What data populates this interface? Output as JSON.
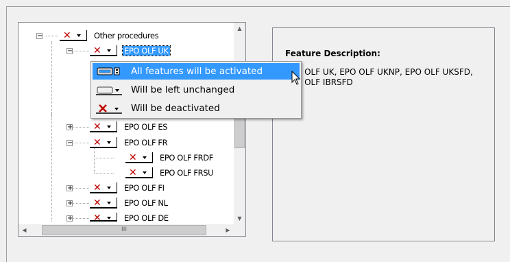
{
  "tree": {
    "nodes": [
      {
        "label": "Other procedures",
        "icon": "x-icon",
        "expander": "minus"
      },
      {
        "label": "EPO OLF UK",
        "icon": "x-icon",
        "expander": "minus",
        "selected": true
      },
      {
        "label": "EPO OLF ES",
        "icon": "x-icon",
        "expander": "plus"
      },
      {
        "label": "EPO OLF FR",
        "icon": "x-icon",
        "expander": "minus"
      },
      {
        "label": "EPO OLF FRDF",
        "icon": "x-icon"
      },
      {
        "label": "EPO OLF FRSU",
        "icon": "x-icon"
      },
      {
        "label": "EPO OLF FI",
        "icon": "x-icon",
        "expander": "plus"
      },
      {
        "label": "EPO OLF NL",
        "icon": "x-icon",
        "expander": "plus"
      },
      {
        "label": "EPO OLF DE",
        "icon": "x-icon",
        "expander": "plus"
      }
    ],
    "scroll_glyph": "III"
  },
  "menu": {
    "items": [
      {
        "label": "All features will be activated",
        "icon": "drive-full-icon",
        "highlighted": true
      },
      {
        "label": "Will be left unchanged",
        "icon": "drive-empty-icon"
      },
      {
        "label": "Will be deactivated",
        "icon": "x-icon"
      }
    ]
  },
  "description": {
    "title": "Feature Description:",
    "text": "EPO OLF UK, EPO OLF UKNP, EPO OLF UKSFD, EPO OLF IBRSFD"
  },
  "colors": {
    "highlight": "#3399ff",
    "x_icon": "#c00000"
  }
}
